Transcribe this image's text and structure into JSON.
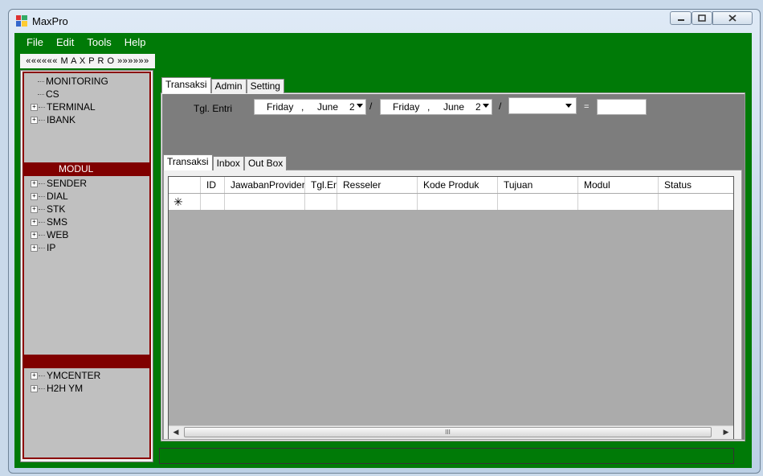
{
  "window": {
    "title": "MaxPro"
  },
  "menu": [
    "File",
    "Edit",
    "Tools",
    "Help"
  ],
  "left_panel": {
    "banner": "«««««« M A X P R O »»»»»»",
    "tree_top": [
      {
        "label": "MONITORING",
        "expandable": false
      },
      {
        "label": "CS",
        "expandable": false
      },
      {
        "label": "TERMINAL",
        "expandable": true
      },
      {
        "label": "IBANK",
        "expandable": true
      }
    ],
    "modul_header": "MODUL",
    "tree_modul": [
      {
        "label": "SENDER",
        "expandable": true
      },
      {
        "label": "DIAL",
        "expandable": true
      },
      {
        "label": "STK",
        "expandable": true
      },
      {
        "label": "SMS",
        "expandable": true
      },
      {
        "label": "WEB",
        "expandable": true
      },
      {
        "label": "IP",
        "expandable": true
      }
    ],
    "tree_bottom": [
      {
        "label": "YMCENTER",
        "expandable": true
      },
      {
        "label": "H2H YM",
        "expandable": true
      }
    ]
  },
  "outer_tabs": [
    "Transaksi",
    "Admin",
    "Setting"
  ],
  "filter": {
    "label": "Tgl. Entri",
    "date_from": {
      "weekday": "Friday",
      "sep": ",",
      "month": "June",
      "day": "2"
    },
    "date_to": {
      "weekday": "Friday",
      "sep": ",",
      "month": "June",
      "day": "2"
    },
    "slash": "/",
    "combo_value": "",
    "equals": "=",
    "result_value": ""
  },
  "inner_tabs": [
    "Transaksi",
    "Inbox",
    "Out Box"
  ],
  "grid": {
    "columns": [
      "",
      "ID",
      "JawabanProvider",
      "Tgl.Entri",
      "Resseler",
      "Kode Produk",
      "Tujuan",
      "Modul",
      "Status"
    ],
    "new_row_marker": "✳",
    "scroll_grip": "III"
  }
}
